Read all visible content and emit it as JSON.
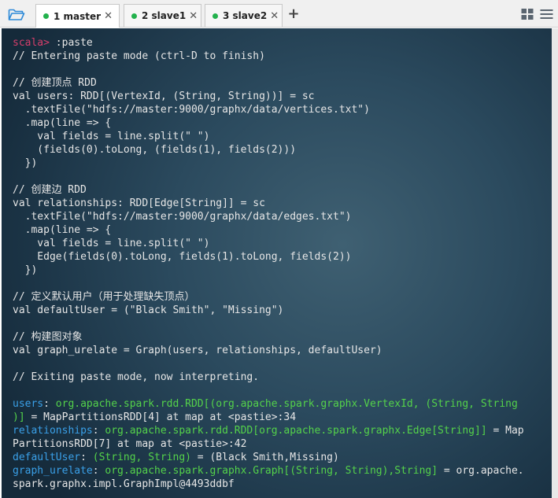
{
  "tabs": [
    {
      "label": "1 master",
      "close": "✕",
      "active": true
    },
    {
      "label": "2 slave1",
      "close": "✕",
      "active": false
    },
    {
      "label": "3 slave2",
      "close": "✕",
      "active": false
    }
  ],
  "tab_add": "+",
  "colors": {
    "tab_dot": "#22b14c",
    "prompt": "#d63e6b",
    "name": "#3aa0e8",
    "type": "#54d24a",
    "text": "#e6e6e6",
    "folder": "#2e8ad8"
  },
  "icons": {
    "folder": "folder-open-icon",
    "grid": "grid-layout-icon",
    "menu": "hamburger-menu-icon"
  },
  "terminal": {
    "prompt": "scala>",
    "l1_cmd": " :paste",
    "l2": "// Entering paste mode (ctrl-D to finish)",
    "l3": "",
    "l4": "// 创建顶点 RDD",
    "l5": "val users: RDD[(VertexId, (String, String))] = sc",
    "l6": "  .textFile(\"hdfs://master:9000/graphx/data/vertices.txt\")",
    "l7": "  .map(line => {",
    "l8": "    val fields = line.split(\" \")",
    "l9": "    (fields(0).toLong, (fields(1), fields(2)))",
    "l10": "  })",
    "l11": "",
    "l12": "// 创建边 RDD",
    "l13": "val relationships: RDD[Edge[String]] = sc",
    "l14": "  .textFile(\"hdfs://master:9000/graphx/data/edges.txt\")",
    "l15": "  .map(line => {",
    "l16": "    val fields = line.split(\" \")",
    "l17": "    Edge(fields(0).toLong, fields(1).toLong, fields(2))",
    "l18": "  })",
    "l19": "",
    "l20": "// 定义默认用户（用于处理缺失顶点）",
    "l21": "val defaultUser = (\"Black Smith\", \"Missing\")",
    "l22": "",
    "l23": "// 构建图对象",
    "l24": "val graph_urelate = Graph(users, relationships, defaultUser)",
    "l25": "",
    "l26": "// Exiting paste mode, now interpreting.",
    "l27": "",
    "r1_name": "users",
    "r1_sep": ": ",
    "r1_type": "org.apache.spark.rdd.RDD[(org.apache.spark.graphx.VertexId, (String, String",
    "r2_type": ")]",
    "r2_val": " = MapPartitionsRDD[4] at map at <pastie>:34",
    "r3_name": "relationships",
    "r3_sep": ": ",
    "r3_type": "org.apache.spark.rdd.RDD[org.apache.spark.graphx.Edge[String]]",
    "r3_val": " = Map",
    "r4_val": "PartitionsRDD[7] at map at <pastie>:42",
    "r5_name": "defaultUser",
    "r5_sep": ": ",
    "r5_type": "(String, String)",
    "r5_val": " = (Black Smith,Missing)",
    "r6_name": "graph_urelate",
    "r6_sep": ": ",
    "r6_type": "org.apache.spark.graphx.Graph[(String, String),String]",
    "r6_val": " = org.apache.",
    "r7_val": "spark.graphx.impl.GraphImpl@4493ddbf"
  }
}
